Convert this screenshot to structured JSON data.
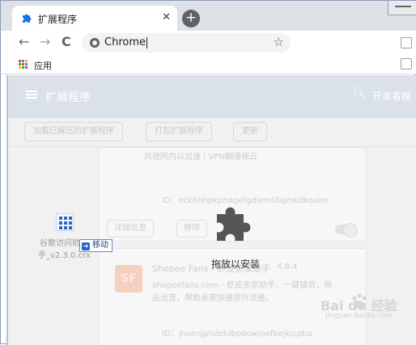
{
  "tab": {
    "title": "扩展程序",
    "close": "✕",
    "icon": "puzzle-icon"
  },
  "newtab": "+",
  "toolbar": {
    "back": "←",
    "forward": "→",
    "reload": "C",
    "omnibox_text": "Chrome",
    "star": "☆"
  },
  "bookmarks": {
    "apps_label": "应用"
  },
  "extensions": {
    "header_title": "扩展程序",
    "dev_mode_label": "开发者模",
    "actions": [
      "加载已解压的扩展程序",
      "打包扩展程序",
      "更新"
    ],
    "card1": {
      "desc": "风驰阿内以加速 | VPN翻墙梯云",
      "id": "ID：ockhnhpkphagefgdiemlifajmkdkoaim",
      "details_btn": "详细信息",
      "remove_btn": "移除"
    },
    "card2": {
      "logo": "SF",
      "name": "Shopee Fans - 虾皮卖家助手",
      "version": "4.8.4",
      "desc1": "shopeefans.com - 虾皮卖家助手，一键铺货，商",
      "desc2": "品运营，帮助卖家快速提升流量。",
      "id": "ID：jholmjphdehlbpdowjoofbejkjcpba"
    }
  },
  "drag": {
    "drop_label": "拖放以安装",
    "file_name_line1": "谷歌访问助",
    "file_name_line2": "手_v2.3.0.crx",
    "move_label": "移动"
  },
  "watermark": {
    "text": "Bai du 经验",
    "sub": "jingyan.baidu.com"
  },
  "colors": {
    "accent": "#1a73e8",
    "header": "#dbe1ea"
  }
}
